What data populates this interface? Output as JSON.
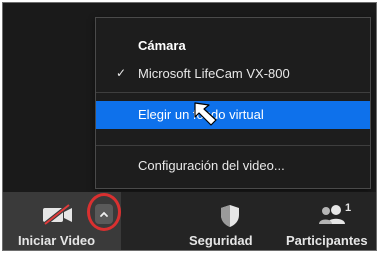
{
  "menu": {
    "section_title": "Cámara",
    "selected_camera": "Microsoft LifeCam VX-800",
    "check_mark": "✓",
    "items": [
      {
        "label": "Elegir un fondo virtual",
        "highlighted": true
      },
      {
        "label": "Configuración del video..."
      }
    ]
  },
  "toolbar": {
    "video_label": "Iniciar Video",
    "security_label": "Seguridad",
    "participants_label": "Participantes",
    "participants_count": "1"
  },
  "icons": {
    "video": "video-off-icon",
    "caret": "chevron-up-icon",
    "security": "shield-icon",
    "participants": "people-icon",
    "cursor": "mouse-pointer-icon"
  },
  "colors": {
    "highlight": "#0e71eb",
    "annotation_ring": "#d93030",
    "video_off_slash": "#e03b3b"
  }
}
